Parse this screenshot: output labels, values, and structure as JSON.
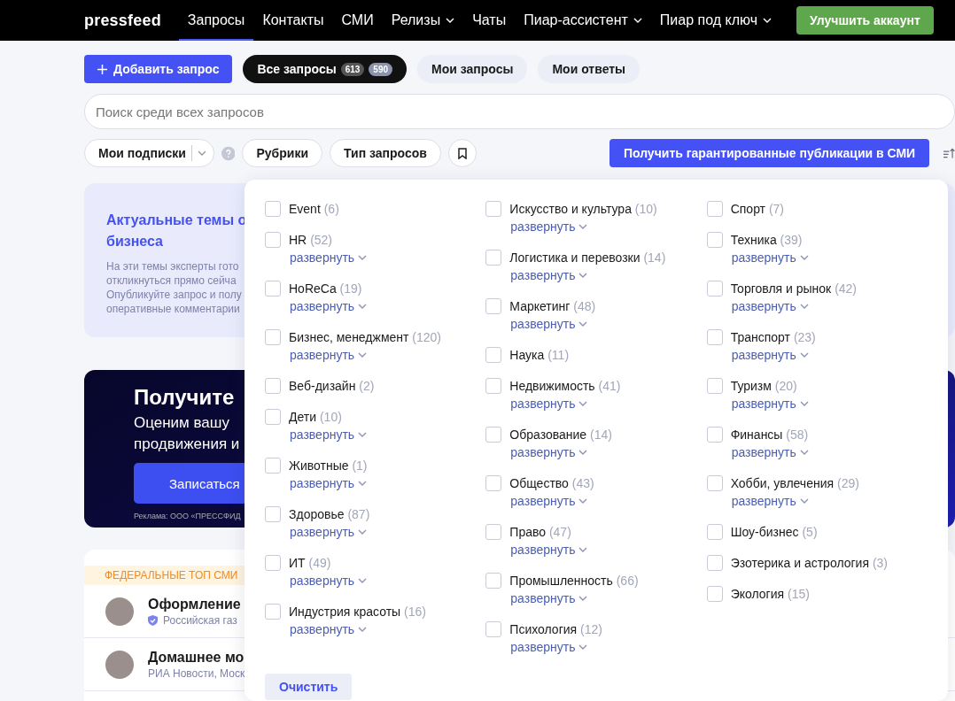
{
  "nav": {
    "logo": "pressfeed",
    "items": [
      {
        "label": "Запросы",
        "selected": true,
        "dropdown": false
      },
      {
        "label": "Контакты",
        "selected": false,
        "dropdown": false
      },
      {
        "label": "СМИ",
        "selected": false,
        "dropdown": false
      },
      {
        "label": "Релизы",
        "selected": false,
        "dropdown": true
      },
      {
        "label": "Чаты",
        "selected": false,
        "dropdown": false
      },
      {
        "label": "Пиар-ассистент",
        "selected": false,
        "dropdown": true
      },
      {
        "label": "Пиар под ключ",
        "selected": false,
        "dropdown": true
      }
    ],
    "upgrade_button": "Улучшить аккаунт"
  },
  "toolbar": {
    "add_button": "Добавить запрос",
    "tabs": [
      {
        "label": "Все запросы",
        "selected": true,
        "counts": [
          "613",
          "590"
        ]
      },
      {
        "label": "Мои запросы",
        "selected": false
      },
      {
        "label": "Мои ответы",
        "selected": false
      }
    ]
  },
  "search": {
    "placeholder": "Поиск среди всех запросов"
  },
  "filters": {
    "subscriptions": "Мои подписки",
    "buttons": [
      "Рубрики",
      "Тип запросов"
    ],
    "promo_button": "Получить гарантированные публикации в СМИ"
  },
  "topics_card": {
    "title_lines": [
      "Актуальные темы о",
      "бизнеса"
    ],
    "text_lines": [
      "На эти темы эксперты гото",
      "откликнуться прямо сейча",
      "Опубликуйте запрос и полу",
      "оперативные комментарии"
    ]
  },
  "banner": {
    "title": "Получите",
    "lines": [
      "Оценим вашу",
      "продвижения и"
    ],
    "button": "Записаться",
    "ad_note": "Реклама: ООО «ПРЕССФИД"
  },
  "requests": {
    "badge": "ФЕДЕРАЛЬНЫЕ ТОП СМИ",
    "rows": [
      {
        "title": "Оформление",
        "source": "Российская газ",
        "verified": true
      },
      {
        "title": "Домашнее мо",
        "source": "РИА Новости, Моск",
        "verified": false
      }
    ]
  },
  "categories": {
    "columns": [
      {
        "items": [
          {
            "label": "Event",
            "count": "(6)",
            "checked": false
          },
          {
            "label": "HR",
            "count": "(52)",
            "checked": false,
            "expand": "развернуть"
          },
          {
            "label": "HoReCa",
            "count": "(19)",
            "checked": false,
            "expand": "развернуть"
          },
          {
            "label": "Бизнес, менеджмент",
            "count": "(120)",
            "checked": false,
            "expand": "развернуть"
          },
          {
            "label": "Веб-дизайн",
            "count": "(2)",
            "checked": false
          },
          {
            "label": "Дети",
            "count": "(10)",
            "checked": false,
            "expand": "развернуть"
          },
          {
            "label": "Животные",
            "count": "(1)",
            "checked": false,
            "expand": "развернуть"
          },
          {
            "label": "Здоровье",
            "count": "(87)",
            "checked": false,
            "expand": "развернуть"
          },
          {
            "label": "ИТ",
            "count": "(49)",
            "checked": false,
            "expand": "развернуть"
          },
          {
            "label": "Индустрия красоты",
            "count": "(16)",
            "checked": false,
            "expand": "развернуть"
          }
        ]
      },
      {
        "items": [
          {
            "label": "Искусство и культура",
            "count": "(10)",
            "checked": false,
            "expand": "развернуть"
          },
          {
            "label": "Логистика и перевозки",
            "count": "(14)",
            "checked": false,
            "expand": "развернуть"
          },
          {
            "label": "Маркетинг",
            "count": "(48)",
            "checked": false,
            "expand": "развернуть"
          },
          {
            "label": "Наука",
            "count": "(11)",
            "checked": false
          },
          {
            "label": "Недвижимость",
            "count": "(41)",
            "checked": false,
            "expand": "развернуть"
          },
          {
            "label": "Образование",
            "count": "(14)",
            "checked": false,
            "expand": "развернуть"
          },
          {
            "label": "Общество",
            "count": "(43)",
            "checked": false,
            "expand": "развернуть"
          },
          {
            "label": "Право",
            "count": "(47)",
            "checked": false,
            "expand": "развернуть"
          },
          {
            "label": "Промышленность",
            "count": "(66)",
            "checked": false,
            "expand": "развернуть"
          },
          {
            "label": "Психология",
            "count": "(12)",
            "checked": false,
            "expand": "развернуть"
          }
        ]
      },
      {
        "items": [
          {
            "label": "Спорт",
            "count": "(7)",
            "checked": false
          },
          {
            "label": "Техника",
            "count": "(39)",
            "checked": false,
            "expand": "развернуть"
          },
          {
            "label": "Торговля и рынок",
            "count": "(42)",
            "checked": false,
            "expand": "развернуть"
          },
          {
            "label": "Транспорт",
            "count": "(23)",
            "checked": false,
            "expand": "развернуть"
          },
          {
            "label": "Туризм",
            "count": "(20)",
            "checked": false,
            "expand": "развернуть"
          },
          {
            "label": "Финансы",
            "count": "(58)",
            "checked": false,
            "expand": "развернуть"
          },
          {
            "label": "Хобби, увлечения",
            "count": "(29)",
            "checked": false,
            "expand": "развернуть"
          },
          {
            "label": "Шоу-бизнес",
            "count": "(5)",
            "checked": false
          },
          {
            "label": "Эзотерика и астрология",
            "count": "(3)",
            "checked": false
          },
          {
            "label": "Экология",
            "count": "(15)",
            "checked": false
          }
        ]
      }
    ],
    "clear_button": "Очистить"
  }
}
